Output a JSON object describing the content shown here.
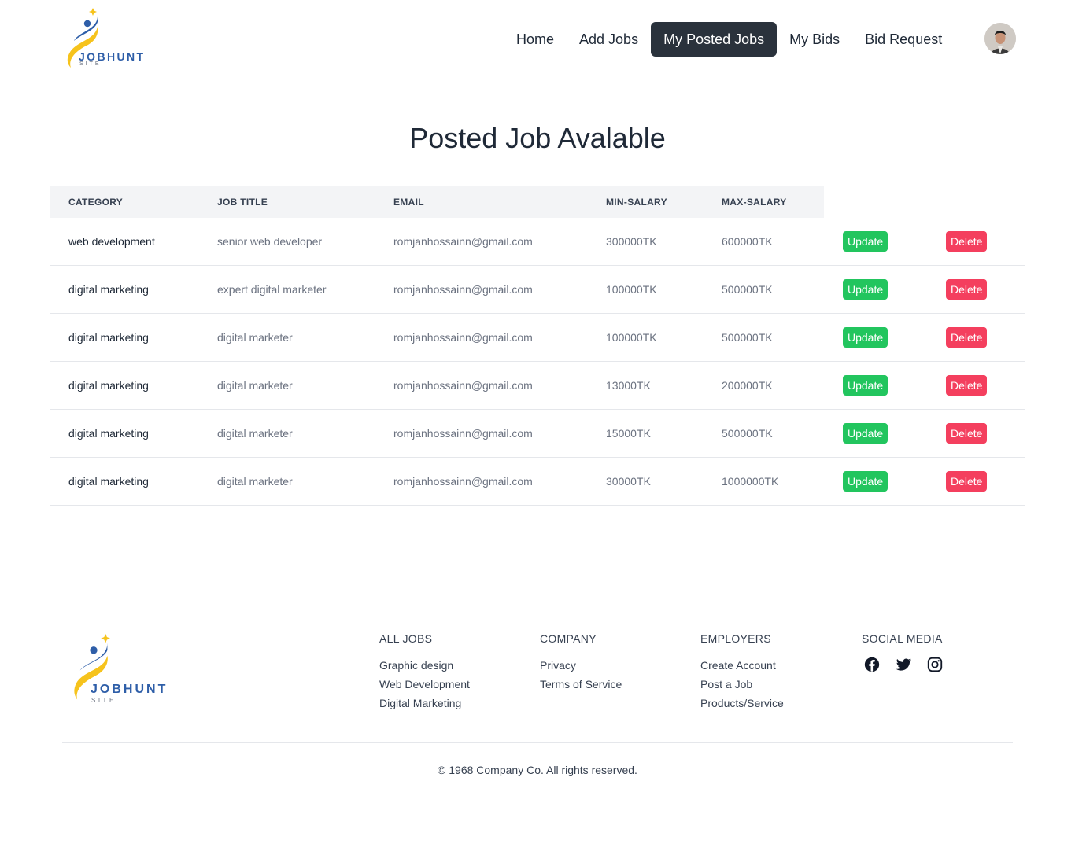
{
  "brand": {
    "name": "JOBHUNT",
    "sub": "SITE"
  },
  "nav": {
    "items": [
      {
        "label": "Home",
        "active": false
      },
      {
        "label": "Add Jobs",
        "active": false
      },
      {
        "label": "My Posted Jobs",
        "active": true
      },
      {
        "label": "My Bids",
        "active": false
      },
      {
        "label": "Bid Request",
        "active": false
      }
    ]
  },
  "page": {
    "title": "Posted Job Avalable"
  },
  "table": {
    "headers": [
      "CATEGORY",
      "JOB TITLE",
      "EMAIL",
      "MIN-SALARY",
      "MAX-SALARY"
    ],
    "update_label": "Update",
    "delete_label": "Delete",
    "rows": [
      {
        "category": "web development",
        "title": "senior web developer",
        "email": "romjanhossainn@gmail.com",
        "min": "300000TK",
        "max": "600000TK"
      },
      {
        "category": "digital marketing",
        "title": "expert digital marketer",
        "email": "romjanhossainn@gmail.com",
        "min": "100000TK",
        "max": "500000TK"
      },
      {
        "category": "digital marketing",
        "title": "digital marketer",
        "email": "romjanhossainn@gmail.com",
        "min": "100000TK",
        "max": "500000TK"
      },
      {
        "category": "digital marketing",
        "title": "digital marketer",
        "email": "romjanhossainn@gmail.com",
        "min": "13000TK",
        "max": "200000TK"
      },
      {
        "category": "digital marketing",
        "title": "digital marketer",
        "email": "romjanhossainn@gmail.com",
        "min": "15000TK",
        "max": "500000TK"
      },
      {
        "category": "digital marketing",
        "title": "digital marketer",
        "email": "romjanhossainn@gmail.com",
        "min": "30000TK",
        "max": "1000000TK"
      }
    ]
  },
  "footer": {
    "columns": [
      {
        "heading": "ALL JOBS",
        "links": [
          "Graphic design",
          "Web Development",
          "Digital Marketing"
        ]
      },
      {
        "heading": "COMPANY",
        "links": [
          "Privacy",
          "Terms of Service"
        ]
      },
      {
        "heading": "EMPLOYERS",
        "links": [
          "Create Account",
          "Post a Job",
          "Products/Service"
        ]
      }
    ],
    "social": {
      "heading": "SOCIAL MEDIA",
      "icons": [
        "facebook-icon",
        "twitter-icon",
        "instagram-icon"
      ]
    },
    "copyright": "© 1968 Company Co. All rights reserved."
  },
  "colors": {
    "accent": "#2a323c",
    "update": "#22c55e",
    "delete": "#f43f5e",
    "brand_blue": "#2e5ea8",
    "brand_yellow": "#f6c31c"
  }
}
